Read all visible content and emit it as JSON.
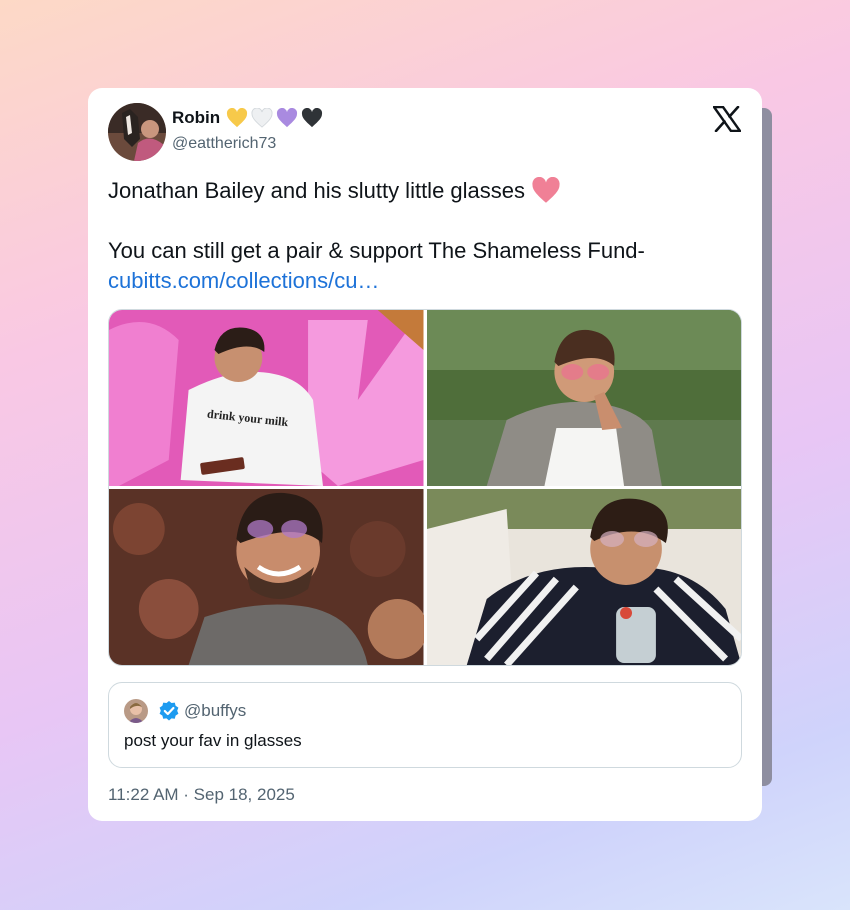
{
  "tweet": {
    "author_name": "Robin",
    "author_handle": "@eattherich73",
    "name_hearts": [
      "yellow-heart-icon",
      "white-heart-icon",
      "purple-heart-icon",
      "black-heart-icon"
    ],
    "text_line1": "Jonathan Bailey and his slutty little glasses",
    "text_line2": "You can still get a pair & support The Shameless Fund-",
    "link_text": "cubitts.com/collections/cu…",
    "timestamp": "11:22 AM · Sep 18, 2025"
  },
  "photos": [
    {
      "name": "photo-pink-backdrop",
      "shirt_text": "drink your milk"
    },
    {
      "name": "photo-outdoor-pink-glasses"
    },
    {
      "name": "photo-crowd-smiling"
    },
    {
      "name": "photo-striped-sweater"
    }
  ],
  "quote": {
    "handle": "@buffys",
    "text": "post your fav in glasses"
  },
  "colors": {
    "link": "#1d72d8",
    "muted": "#536471",
    "text": "#0f1419",
    "verified": "#1d9bf0",
    "heart_pink": "#f08096"
  }
}
